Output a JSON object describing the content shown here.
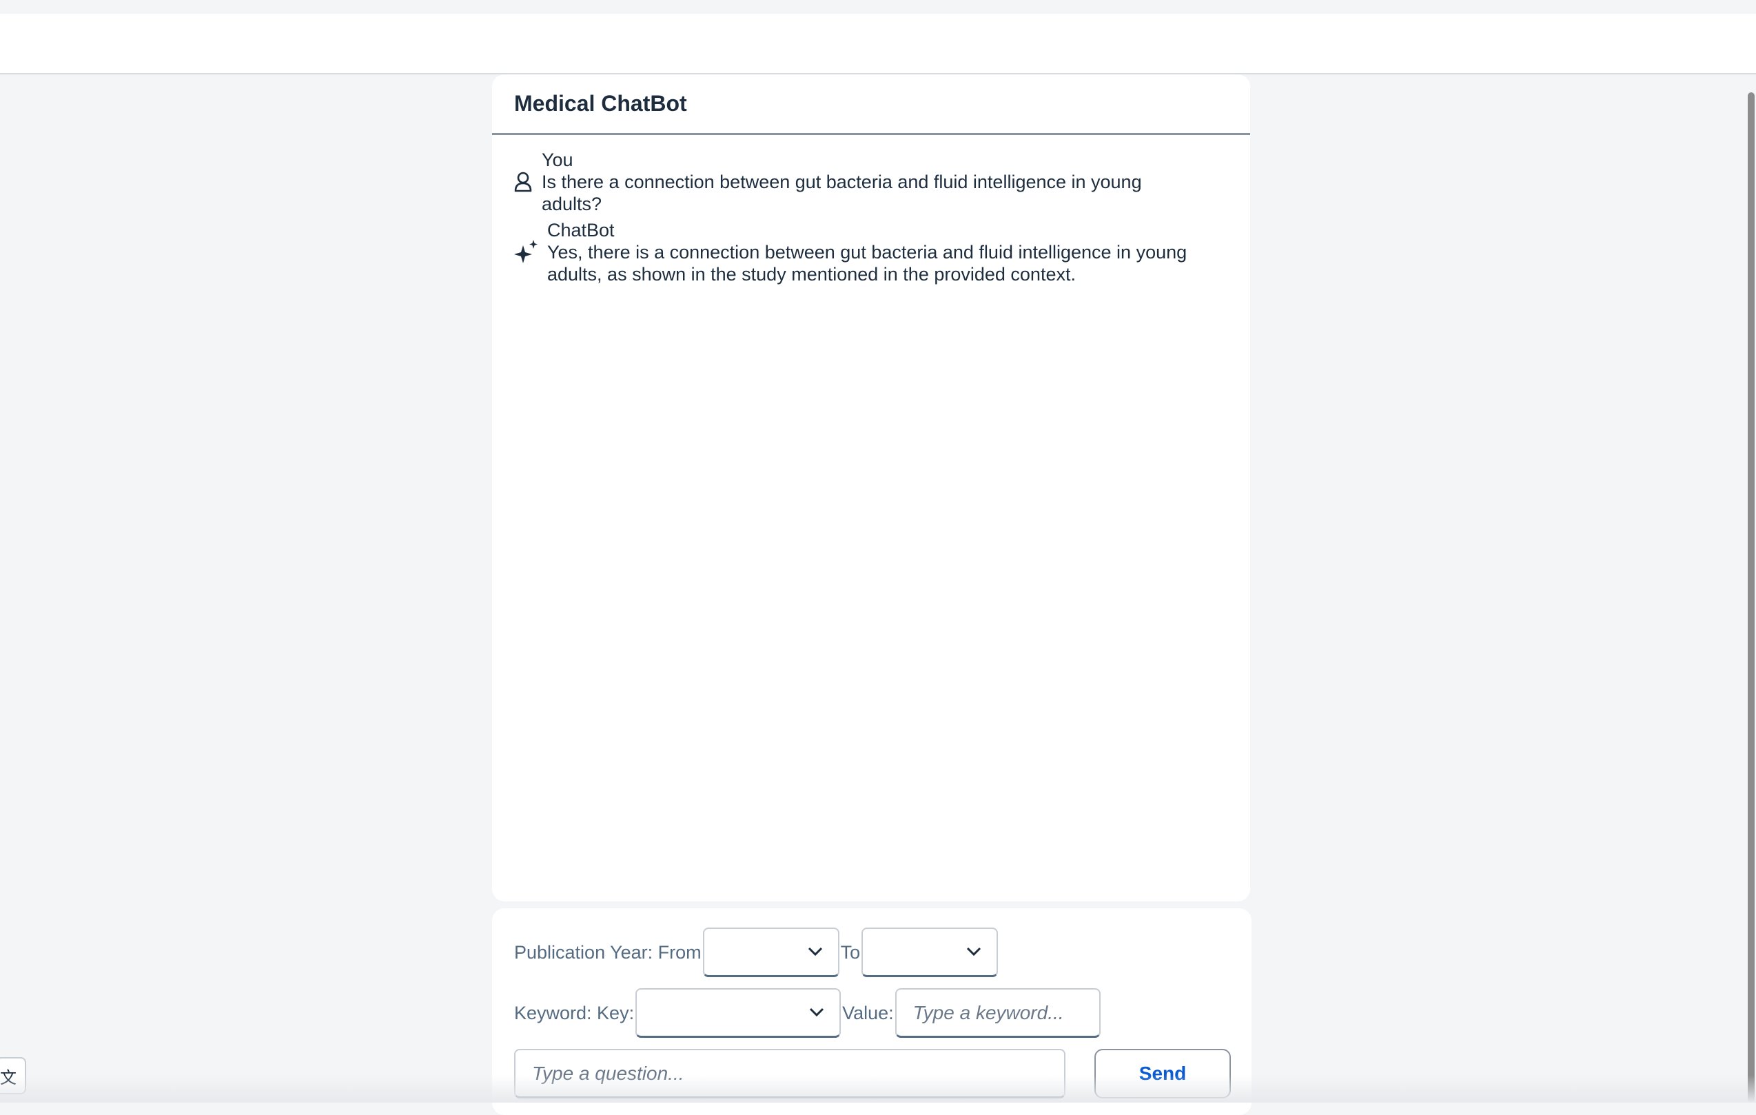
{
  "header": {
    "title": ""
  },
  "chat": {
    "title": "Medical ChatBot",
    "messages": [
      {
        "author": "You",
        "icon": "user-icon",
        "text": "Is there a connection between gut bacteria and fluid intelligence in young adults?"
      },
      {
        "author": "ChatBot",
        "icon": "sparkle-icon",
        "text": "Yes, there is a connection between gut bacteria and fluid intelligence in young adults, as shown in the study mentioned in the provided context."
      }
    ]
  },
  "filters": {
    "publication_year_label": "Publication Year: From",
    "from_value": "",
    "to_label": "To",
    "to_value": "",
    "keyword_key_label": "Keyword: Key:",
    "keyword_key_value": "",
    "value_label": "Value:",
    "keyword_placeholder": "Type a keyword...",
    "question_placeholder": "Type a question...",
    "send_label": "Send"
  },
  "side_tab": {
    "label": "文"
  },
  "colors": {
    "accent": "#0a5bd3",
    "text": "#1d2d3e",
    "muted": "#556b82",
    "background": "#f4f5f7"
  }
}
